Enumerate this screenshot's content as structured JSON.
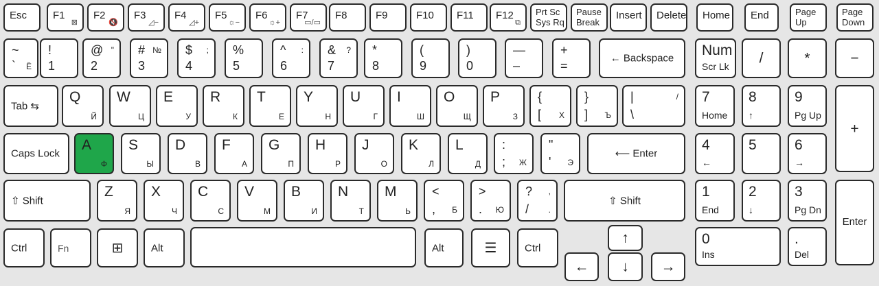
{
  "keyboard": {
    "fn_row": [
      {
        "id": "esc",
        "label": "Esc"
      },
      {
        "id": "f1",
        "label": "F1",
        "icon": "touchpad-off-icon",
        "glyph": "⊠"
      },
      {
        "id": "f2",
        "label": "F2",
        "icon": "mute-icon",
        "glyph": "🔇"
      },
      {
        "id": "f3",
        "label": "F3",
        "icon": "volume-down-icon",
        "glyph": "◿−"
      },
      {
        "id": "f4",
        "label": "F4",
        "icon": "volume-up-icon",
        "glyph": "◿+"
      },
      {
        "id": "f5",
        "label": "F5",
        "icon": "brightness-down-icon",
        "glyph": "☼−"
      },
      {
        "id": "f6",
        "label": "F6",
        "icon": "brightness-up-icon",
        "glyph": "☼+"
      },
      {
        "id": "f7",
        "label": "F7",
        "icon": "display-switch-icon",
        "glyph": "▭/▭"
      },
      {
        "id": "f8",
        "label": "F8"
      },
      {
        "id": "f9",
        "label": "F9"
      },
      {
        "id": "f10",
        "label": "F10"
      },
      {
        "id": "f11",
        "label": "F11"
      },
      {
        "id": "f12",
        "label": "F12",
        "icon": "window-icon",
        "glyph": "⧉"
      },
      {
        "id": "prtsc",
        "label": "Prt Sc",
        "label2": "Sys Rq"
      },
      {
        "id": "pause",
        "label": "Pause",
        "label2": "Break"
      },
      {
        "id": "insert",
        "label": "Insert"
      },
      {
        "id": "delete",
        "label": "Delete"
      },
      {
        "id": "home",
        "label": "Home"
      },
      {
        "id": "end",
        "label": "End"
      },
      {
        "id": "pageup",
        "label": "Page",
        "label2": "Up"
      },
      {
        "id": "pagedown",
        "label": "Page",
        "label2": "Down"
      }
    ],
    "number_row": [
      {
        "id": "tilde",
        "tl": "~",
        "bl": "`",
        "br": "Ё"
      },
      {
        "id": "1",
        "tl": "!",
        "bl": "1"
      },
      {
        "id": "2",
        "tl": "@",
        "tr": "\"",
        "bl": "2"
      },
      {
        "id": "3",
        "tl": "#",
        "tr": "№",
        "bl": "3"
      },
      {
        "id": "4",
        "tl": "$",
        "tr": ";",
        "bl": "4"
      },
      {
        "id": "5",
        "tl": "%",
        "bl": "5"
      },
      {
        "id": "6",
        "tl": "^",
        "tr": ":",
        "bl": "6"
      },
      {
        "id": "7",
        "tl": "&",
        "tr": "?",
        "bl": "7"
      },
      {
        "id": "8",
        "tl": "*",
        "bl": "8"
      },
      {
        "id": "9",
        "tl": "(",
        "bl": "9"
      },
      {
        "id": "0",
        "tl": ")",
        "bl": "0"
      },
      {
        "id": "minus",
        "tl": "—",
        "bl": "–"
      },
      {
        "id": "equal",
        "tl": "+",
        "bl": "="
      },
      {
        "id": "backspace",
        "label": "← Backspace"
      },
      {
        "id": "numlk",
        "label": "Num Lk",
        "label2": "Scr Lk"
      },
      {
        "id": "numdiv",
        "label": "/"
      },
      {
        "id": "nummul",
        "label": "*"
      },
      {
        "id": "numsub",
        "label": "−"
      }
    ],
    "q_row": [
      {
        "id": "tab",
        "label": "Tab ⇆"
      },
      {
        "id": "q",
        "en": "Q",
        "ru": "Й"
      },
      {
        "id": "w",
        "en": "W",
        "ru": "Ц"
      },
      {
        "id": "e",
        "en": "E",
        "ru": "У"
      },
      {
        "id": "r",
        "en": "R",
        "ru": "К"
      },
      {
        "id": "t",
        "en": "T",
        "ru": "Е"
      },
      {
        "id": "y",
        "en": "Y",
        "ru": "Н"
      },
      {
        "id": "u",
        "en": "U",
        "ru": "Г"
      },
      {
        "id": "i",
        "en": "I",
        "ru": "Ш"
      },
      {
        "id": "o",
        "en": "O",
        "ru": "Щ"
      },
      {
        "id": "p",
        "en": "P",
        "ru": "З"
      },
      {
        "id": "lbracket",
        "tl": "{",
        "bl": "[",
        "br": "Х"
      },
      {
        "id": "rbracket",
        "tl": "}",
        "bl": "]",
        "br": "Ъ"
      },
      {
        "id": "backslash",
        "tl": "|",
        "tr": "/",
        "bl": "\\"
      },
      {
        "id": "num7",
        "label": "7",
        "label2": "Home"
      },
      {
        "id": "num8",
        "label": "8",
        "label2": "↑"
      },
      {
        "id": "num9",
        "label": "9",
        "label2": "Pg Up"
      },
      {
        "id": "numadd",
        "label": "+"
      }
    ],
    "a_row": [
      {
        "id": "caps",
        "label": "Caps Lock"
      },
      {
        "id": "a",
        "en": "A",
        "ru": "Ф",
        "highlight": true
      },
      {
        "id": "s",
        "en": "S",
        "ru": "Ы"
      },
      {
        "id": "d",
        "en": "D",
        "ru": "В"
      },
      {
        "id": "f",
        "en": "F",
        "ru": "А"
      },
      {
        "id": "g",
        "en": "G",
        "ru": "П"
      },
      {
        "id": "h",
        "en": "H",
        "ru": "Р"
      },
      {
        "id": "j",
        "en": "J",
        "ru": "О"
      },
      {
        "id": "k",
        "en": "K",
        "ru": "Л"
      },
      {
        "id": "l",
        "en": "L",
        "ru": "Д"
      },
      {
        "id": "semicolon",
        "tl": ":",
        "bl": ";",
        "br": "Ж"
      },
      {
        "id": "quote",
        "tl": "\"",
        "bl": "'",
        "br": "Э"
      },
      {
        "id": "enter",
        "label": "⟵ Enter"
      },
      {
        "id": "num4",
        "label": "4",
        "label2": "←"
      },
      {
        "id": "num5",
        "label": "5"
      },
      {
        "id": "num6",
        "label": "6",
        "label2": "→"
      }
    ],
    "z_row": [
      {
        "id": "lshift",
        "label": "⇧ Shift"
      },
      {
        "id": "z",
        "en": "Z",
        "ru": "Я"
      },
      {
        "id": "x",
        "en": "X",
        "ru": "Ч"
      },
      {
        "id": "c",
        "en": "C",
        "ru": "С"
      },
      {
        "id": "v",
        "en": "V",
        "ru": "М"
      },
      {
        "id": "b",
        "en": "B",
        "ru": "И"
      },
      {
        "id": "n",
        "en": "N",
        "ru": "Т"
      },
      {
        "id": "m",
        "en": "M",
        "ru": "Ь"
      },
      {
        "id": "comma",
        "tl": "<",
        "bl": ",",
        "br": "Б"
      },
      {
        "id": "period",
        "tl": ">",
        "bl": ".",
        "br": "Ю"
      },
      {
        "id": "slash",
        "tl": "?",
        "tr": ",",
        "bl": "/",
        "br": "."
      },
      {
        "id": "rshift",
        "label": "⇧ Shift"
      },
      {
        "id": "num1",
        "label": "1",
        "label2": "End"
      },
      {
        "id": "num2",
        "label": "2",
        "label2": "↓"
      },
      {
        "id": "num3",
        "label": "3",
        "label2": "Pg Dn"
      },
      {
        "id": "numenter",
        "label": "Enter"
      }
    ],
    "bottom_row": [
      {
        "id": "lctrl",
        "label": "Ctrl"
      },
      {
        "id": "fn",
        "label": "Fn"
      },
      {
        "id": "win",
        "icon": "windows-logo-icon",
        "glyph": "⊞"
      },
      {
        "id": "lalt",
        "label": "Alt"
      },
      {
        "id": "space",
        "label": ""
      },
      {
        "id": "ralt",
        "label": "Alt"
      },
      {
        "id": "menu",
        "icon": "context-menu-icon",
        "glyph": "☰"
      },
      {
        "id": "rctrl",
        "label": "Ctrl"
      },
      {
        "id": "up",
        "label": "↑"
      },
      {
        "id": "left",
        "label": "←"
      },
      {
        "id": "down",
        "label": "↓"
      },
      {
        "id": "right",
        "label": "→"
      },
      {
        "id": "num0",
        "label": "0",
        "label2": "Ins"
      },
      {
        "id": "numdel",
        "label": ".",
        "label2": "Del"
      }
    ]
  }
}
